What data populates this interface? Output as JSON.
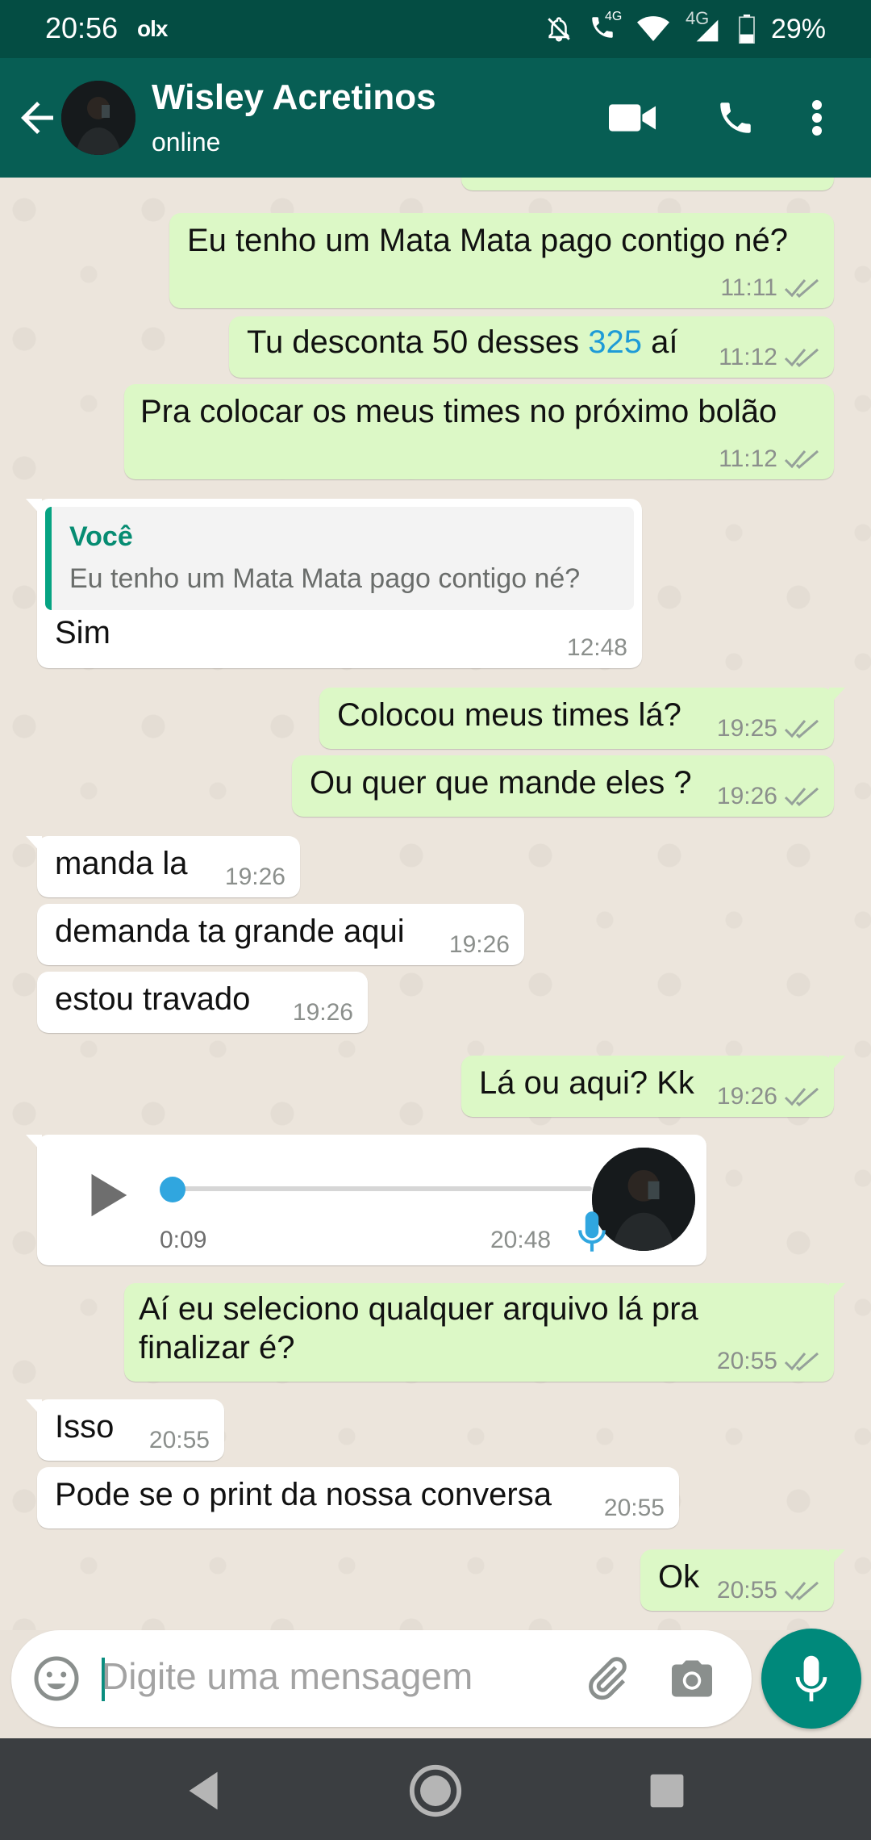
{
  "status_bar": {
    "time": "20:56",
    "carrier_logo": "olx",
    "network_label": "4G",
    "network_label_2": "4G",
    "battery": "29%",
    "icons": [
      "silent-bell-icon",
      "wifi-call-icon",
      "wifi-icon",
      "signal-icon",
      "battery-icon"
    ]
  },
  "header": {
    "contact_name": "Wisley Acretinos",
    "status": "online",
    "icons": [
      "back-arrow-icon",
      "video-call-icon",
      "phone-icon",
      "more-vert-icon"
    ],
    "color": "#075e54"
  },
  "messages": [
    {
      "dir": "out",
      "text": "Eu tenho um Mata Mata pago contigo né?",
      "time": "11:11",
      "ticks": "read"
    },
    {
      "dir": "out",
      "text_before": "Tu desconta 50 desses ",
      "link": "325",
      "text_after": " aí",
      "time": "11:12",
      "ticks": "read"
    },
    {
      "dir": "out",
      "text": "Pra colocar os meus times no próximo bolão",
      "time": "11:12",
      "ticks": "read"
    },
    {
      "dir": "in",
      "quote_author": "Você",
      "quote_text": "Eu tenho um Mata Mata pago contigo né?",
      "text": "Sim",
      "time": "12:48"
    },
    {
      "dir": "out",
      "text": "Colocou meus times lá?",
      "time": "19:25",
      "ticks": "read"
    },
    {
      "dir": "out",
      "text": "Ou quer que mande eles ?",
      "time": "19:26",
      "ticks": "read"
    },
    {
      "dir": "in",
      "text": "manda la",
      "time": "19:26"
    },
    {
      "dir": "in",
      "text": "demanda ta grande aqui",
      "time": "19:26"
    },
    {
      "dir": "in",
      "text": "estou travado",
      "time": "19:26"
    },
    {
      "dir": "out",
      "text": "Lá ou aqui? Kk",
      "time": "19:26",
      "ticks": "read"
    },
    {
      "dir": "in",
      "type": "voice",
      "duration": "0:09",
      "time": "20:48",
      "progress": 0.0
    },
    {
      "dir": "out",
      "text": "Aí eu seleciono qualquer arquivo lá pra finalizar é?",
      "time": "20:55",
      "ticks": "read"
    },
    {
      "dir": "in",
      "text": "Isso",
      "time": "20:55"
    },
    {
      "dir": "in",
      "text": "Pode se o print da nossa conversa",
      "time": "20:55"
    },
    {
      "dir": "out",
      "text": "Ok",
      "time": "20:55",
      "ticks": "read"
    }
  ],
  "input": {
    "placeholder": "Digite uma mensagem",
    "value": "",
    "icons": [
      "emoji-icon",
      "attach-icon",
      "camera-icon",
      "mic-icon"
    ]
  },
  "nav": {
    "icons": [
      "back-triangle-icon",
      "home-circle-icon",
      "recents-square-icon"
    ]
  },
  "colors": {
    "outgoing_bubble": "#dcf8c6",
    "incoming_bubble": "#ffffff",
    "accent": "#00897b",
    "link": "#1e9bd7",
    "quote_author": "#068c72"
  }
}
